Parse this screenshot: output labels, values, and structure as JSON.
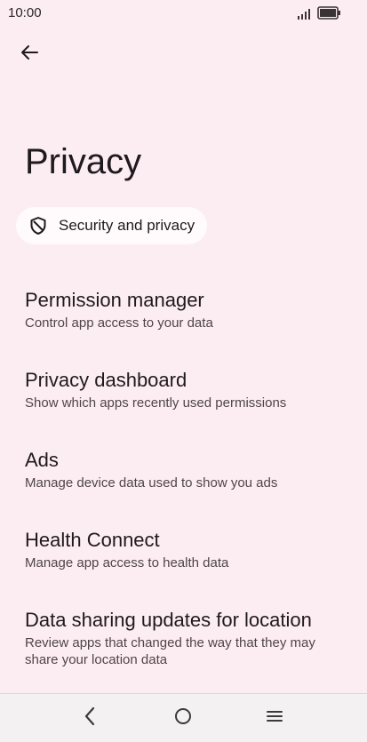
{
  "status_bar": {
    "time": "10:00",
    "icons": [
      "signal-icon",
      "battery-icon"
    ]
  },
  "header": {
    "back_icon": "arrow-left-icon",
    "title": "Privacy"
  },
  "chip": {
    "icon": "shield-icon",
    "label": "Security and privacy"
  },
  "settings": [
    {
      "title": "Permission manager",
      "summary": "Control app access to your data"
    },
    {
      "title": "Privacy dashboard",
      "summary": "Show which apps recently used permissions"
    },
    {
      "title": "Ads",
      "summary": "Manage device data used to show you ads"
    },
    {
      "title": "Health Connect",
      "summary": "Manage app access to health data"
    },
    {
      "title": "Data sharing updates for location",
      "summary": "Review apps that changed the way that they may share your location data"
    }
  ],
  "nav_bar": {
    "icons": [
      "back-triangle-icon",
      "home-circle-icon",
      "menu-lines-icon"
    ]
  },
  "colors": {
    "background": "#fcedf3",
    "chip_background": "#fffafc",
    "text_primary": "#1f1a1d",
    "text_secondary": "#4f4549",
    "nav_background": "#f4f1f2"
  }
}
